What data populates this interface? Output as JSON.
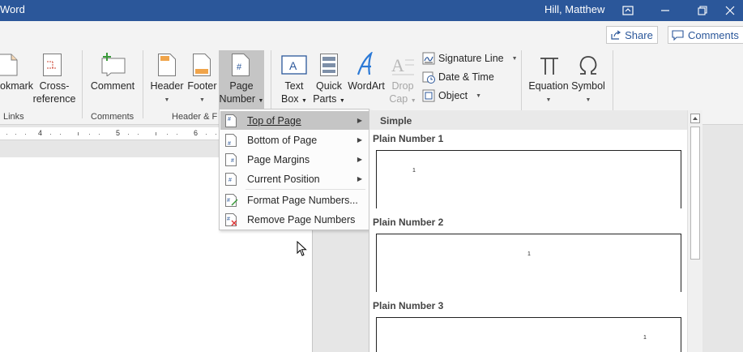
{
  "titlebar": {
    "app_title": "Word",
    "user_name": "Hill, Matthew"
  },
  "ribbon": {
    "share_label": "Share",
    "comments_label": "Comments",
    "links_group": {
      "bookmark_label": "okmark",
      "crossref_line1": "Cross-",
      "crossref_line2": "reference",
      "group_label": "Links"
    },
    "comments_group": {
      "comment_label": "Comment",
      "group_label": "Comments"
    },
    "header_footer_group": {
      "header_label": "Header",
      "footer_label": "Footer",
      "page_number_line1": "Page",
      "page_number_line2": "Number",
      "group_label": "Header & F"
    },
    "text_group": {
      "textbox_line1": "Text",
      "textbox_line2": "Box",
      "quickparts_line1": "Quick",
      "quickparts_line2": "Parts",
      "wordart_label": "WordArt",
      "dropcap_line1": "Drop",
      "dropcap_line2": "Cap",
      "signature_line": "Signature Line",
      "date_time": "Date & Time",
      "object": "Object"
    },
    "symbols_group": {
      "equation_label": "Equation",
      "symbol_label": "Symbol"
    }
  },
  "ruler": {
    "numbers": [
      "4",
      "5",
      "6"
    ]
  },
  "page_number_menu": {
    "items": [
      {
        "label": "Top of Page",
        "has_submenu": true,
        "highlighted": true
      },
      {
        "label": "Bottom of Page",
        "has_submenu": true,
        "highlighted": false
      },
      {
        "label": "Page Margins",
        "has_submenu": true,
        "highlighted": false
      },
      {
        "label": "Current Position",
        "has_submenu": true,
        "highlighted": false
      },
      {
        "label": "Format Page Numbers...",
        "has_submenu": false,
        "highlighted": false
      },
      {
        "label": "Remove Page Numbers",
        "has_submenu": false,
        "highlighted": false
      }
    ]
  },
  "gallery": {
    "section_header": "Simple",
    "items": [
      {
        "title": "Plain Number 1",
        "sample_number": "1",
        "alignment": "left"
      },
      {
        "title": "Plain Number 2",
        "sample_number": "1",
        "alignment": "center"
      },
      {
        "title": "Plain Number 3",
        "sample_number": "1",
        "alignment": "right"
      }
    ]
  },
  "colors": {
    "titlebar_bg": "#2b579a",
    "ribbon_bg": "#f3f3f3",
    "highlight": "#c5c5c5",
    "accent_green": "#3a9a3a",
    "accent_blue": "#2b579a"
  }
}
